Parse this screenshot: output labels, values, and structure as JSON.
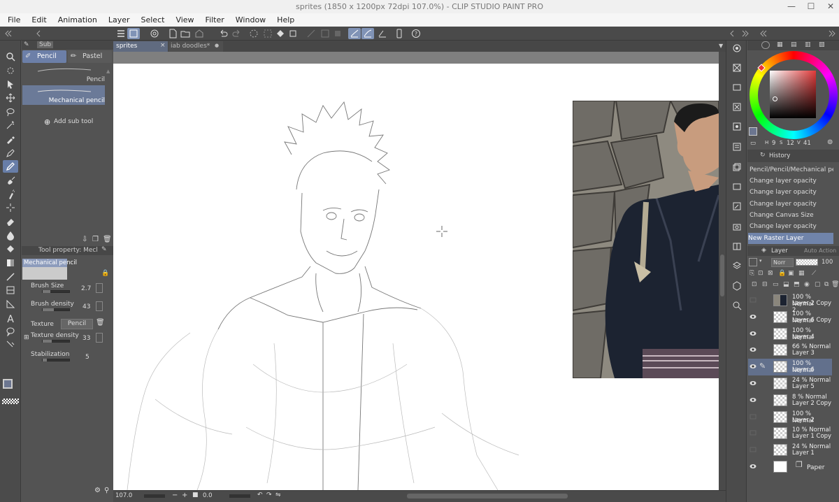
{
  "window": {
    "title": "sprites (1850 x 1200px 72dpi 107.0%)  - CLIP STUDIO PAINT PRO",
    "minimize": "—",
    "maximize": "☐",
    "close": "✕"
  },
  "menu": [
    "File",
    "Edit",
    "Animation",
    "Layer",
    "Select",
    "View",
    "Filter",
    "Window",
    "Help"
  ],
  "tabs": [
    {
      "label": "sprites",
      "close": "×"
    },
    {
      "label": "iab doodles*",
      "close": "●"
    }
  ],
  "subtool": {
    "header": "Sub",
    "groups": [
      "Pencil",
      "Pastel"
    ],
    "items": [
      {
        "label": "Pencil"
      },
      {
        "label": "Mechanical pencil"
      }
    ],
    "add_label": "Add sub tool"
  },
  "tool_property": {
    "header": "Tool property: Mecl",
    "tool_name": "Mechanical pencil",
    "rows": [
      {
        "label": "Brush Size",
        "value": "2.7",
        "level": 0.3
      },
      {
        "label": "Brush density",
        "value": "43",
        "level": 0.43
      },
      {
        "label": "Texture",
        "value": "Pencil"
      },
      {
        "label": "Texture density",
        "value": "33",
        "level": 0.33
      },
      {
        "label": "Stabilization",
        "value": "5",
        "level": 0.15
      }
    ]
  },
  "status": {
    "zoom": "107.0",
    "rotation": "0.0"
  },
  "color_panel": {
    "values": [
      "9",
      "12",
      "41"
    ],
    "accent": "#c9c9c9"
  },
  "history": {
    "tab": "History",
    "items": [
      "Pencil/Pencil/Mechanical pencil",
      "Change layer opacity",
      "Change layer opacity",
      "Change layer opacity",
      "Change Canvas Size",
      "Change layer opacity",
      "New Raster Layer"
    ],
    "selected_index": 6
  },
  "layers": {
    "tab": "Layer",
    "tab2": "Auto Action",
    "blend": "Norr",
    "opacity": "100",
    "items": [
      {
        "line1": "100 % Normal",
        "line2": "Layer 2 Copy 2",
        "visible": false,
        "photo": true
      },
      {
        "line1": "100 % Normal",
        "line2": "Layer 6 Copy",
        "visible": true
      },
      {
        "line1": "100 % Normal",
        "line2": "Layer 4",
        "visible": true
      },
      {
        "line1": "66 % Normal",
        "line2": "Layer 3",
        "visible": true
      },
      {
        "line1": "100 % Normal",
        "line2": "Layer 6",
        "visible": true,
        "selected": true
      },
      {
        "line1": "24 % Normal",
        "line2": "Layer 5",
        "visible": true
      },
      {
        "line1": "8 % Normal",
        "line2": "Layer 2 Copy",
        "visible": true
      },
      {
        "line1": "100 % Normal",
        "line2": "Layer 2",
        "visible": false
      },
      {
        "line1": "10 % Normal",
        "line2": "Layer 1 Copy",
        "visible": false
      },
      {
        "line1": "24 % Normal",
        "line2": "Layer 1",
        "visible": false
      },
      {
        "line1": "",
        "line2": "Paper",
        "visible": true,
        "paper": true
      }
    ]
  }
}
